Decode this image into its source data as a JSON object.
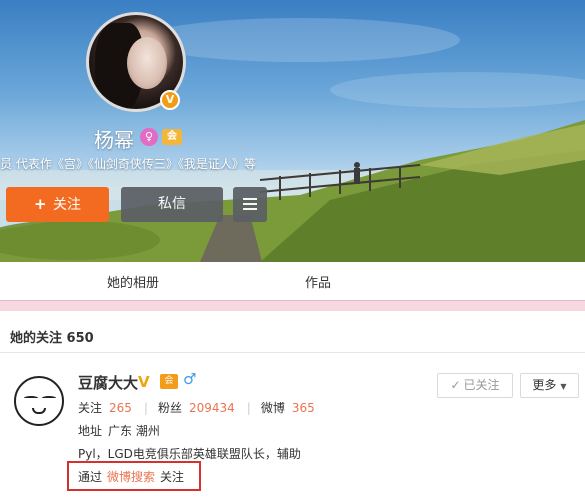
{
  "profile": {
    "name": "杨幂",
    "verified_badge": "V",
    "vip_badge": "会",
    "gender_badge": "♀",
    "works_line": "员  代表作《宫》《仙剑奇侠传三》《我是证人》等",
    "follow_button": "关注",
    "follow_icon": "+",
    "message_button": "私信"
  },
  "tabs": [
    {
      "label": "她的相册"
    },
    {
      "label": "作品"
    }
  ],
  "following": {
    "title": "她的关注 650"
  },
  "user_card": {
    "name": "豆腐大大",
    "verified": "V",
    "house_badge": "会",
    "gender": "♂",
    "stats": {
      "follow_label": "关注",
      "follow_value": "265",
      "fans_label": "粉丝",
      "fans_value": "209434",
      "weibo_label": "微博",
      "weibo_value": "365"
    },
    "address_label": "地址",
    "address_value": "广东 潮州",
    "bio": "Pyl，LGD电竞俱乐部英雄联盟队长，辅助",
    "via_prefix": "通过",
    "via_link": "微博搜索",
    "via_suffix": "关注",
    "followed_button": "已关注",
    "followed_check": "✓",
    "more_button": "更多",
    "more_caret": "▼"
  },
  "colors": {
    "follow_orange": "#f26b21",
    "link_orange": "#eb7350",
    "highlight_red": "#d6312e"
  }
}
